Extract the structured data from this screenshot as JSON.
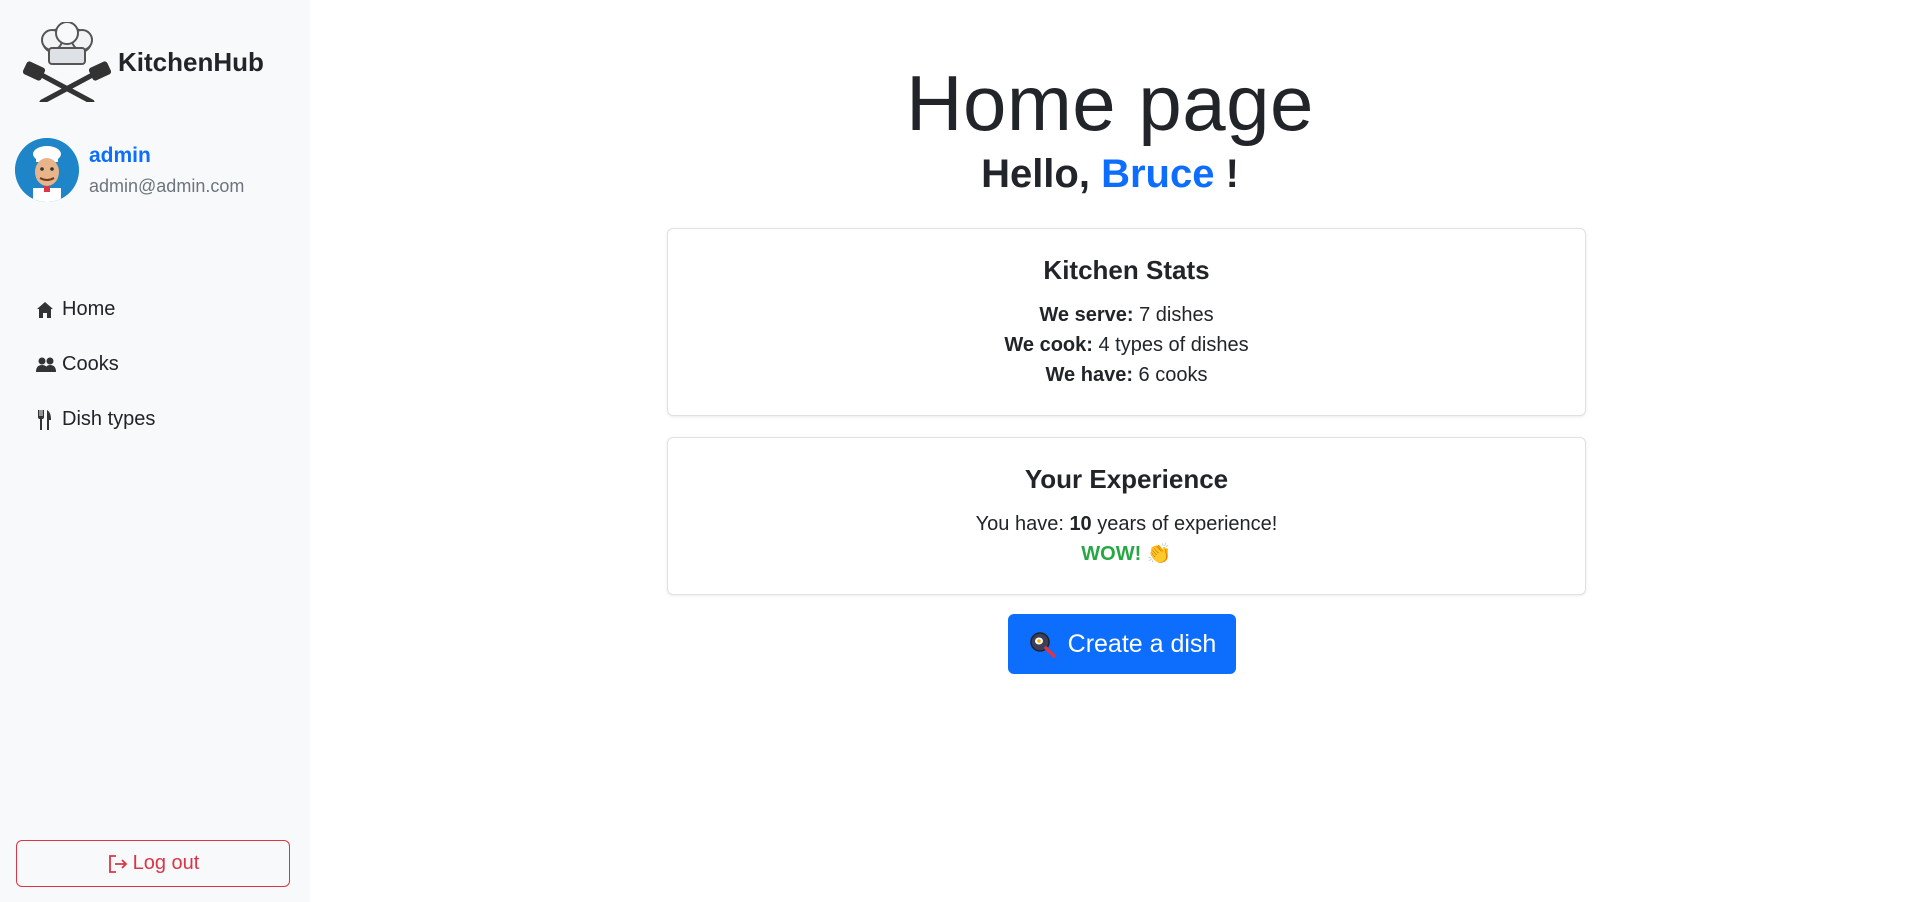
{
  "app": {
    "name": "KitchenHub"
  },
  "user": {
    "username": "admin",
    "email": "admin@admin.com"
  },
  "sidebar": {
    "items": [
      {
        "label": "Home",
        "icon": "house-icon"
      },
      {
        "label": "Cooks",
        "icon": "people-icon"
      },
      {
        "label": "Dish types",
        "icon": "utensils-icon"
      }
    ],
    "logout_label": "Log out"
  },
  "main": {
    "title": "Home page",
    "greeting_prefix": "Hello, ",
    "greeting_name": "Bruce",
    "greeting_suffix": " !",
    "stats": {
      "title": "Kitchen Stats",
      "serve_label": "We serve:",
      "serve_value": " 7 dishes",
      "cook_label": "We cook:",
      "cook_value": " 4 types of dishes",
      "have_label": "We have:",
      "have_value": " 6 cooks"
    },
    "experience": {
      "title": "Your Experience",
      "prefix": "You have: ",
      "years": "10",
      "suffix": " years of experience!",
      "wow": "WOW!",
      "clap": "👏"
    },
    "create_button": "Create a dish"
  },
  "colors": {
    "accent": "#0d6efd",
    "danger": "#dc3545",
    "success": "#28a745",
    "sidebar_bg": "#f8f9fa"
  }
}
